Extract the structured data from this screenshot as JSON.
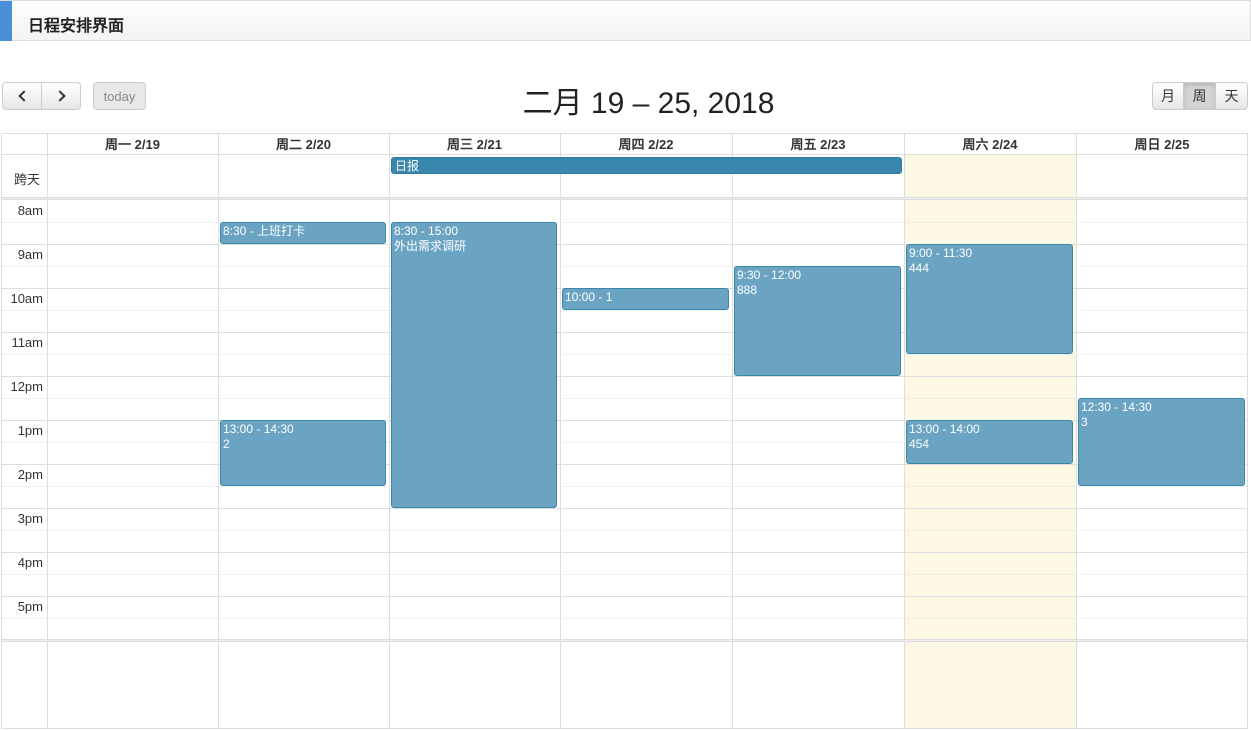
{
  "panel": {
    "title": "日程安排界面"
  },
  "toolbar": {
    "today_label": "today",
    "view_title": "二月 19 – 25, 2018",
    "views": {
      "month": "月",
      "week": "周",
      "day": "天"
    },
    "active_view": "周"
  },
  "calendar": {
    "allday_label": "跨天",
    "days": [
      {
        "label": "周一 2/19"
      },
      {
        "label": "周二 2/20"
      },
      {
        "label": "周三 2/21"
      },
      {
        "label": "周四 2/22"
      },
      {
        "label": "周五 2/23"
      },
      {
        "label": "周六 2/24"
      },
      {
        "label": "周日 2/25"
      }
    ],
    "hours": [
      "8am",
      "9am",
      "10am",
      "11am",
      "12pm",
      "1pm",
      "2pm",
      "3pm",
      "4pm",
      "5pm"
    ],
    "allday_events": [
      {
        "title": "日报",
        "start_day": "周三 2/21",
        "end_day": "周五 2/23"
      }
    ],
    "events": [
      {
        "day": "周二 2/20",
        "time": "8:30 - 上班打卡",
        "title": "",
        "start": 8.5,
        "end": 9.0
      },
      {
        "day": "周二 2/20",
        "time": "13:00 - 14:30",
        "title": "2",
        "start": 13.0,
        "end": 14.5
      },
      {
        "day": "周三 2/21",
        "time": "8:30 - 15:00",
        "title": "外出需求调研",
        "start": 8.5,
        "end": 15.0
      },
      {
        "day": "周四 2/22",
        "time": "10:00 - 1",
        "title": "",
        "start": 10.0,
        "end": 10.5
      },
      {
        "day": "周五 2/23",
        "time": "9:30 - 12:00",
        "title": "888",
        "start": 9.5,
        "end": 12.0
      },
      {
        "day": "周六 2/24",
        "time": "9:00 - 11:30",
        "title": "444",
        "start": 9.0,
        "end": 11.5
      },
      {
        "day": "周六 2/24",
        "time": "13:00 - 14:00",
        "title": "454",
        "start": 13.0,
        "end": 14.0
      },
      {
        "day": "周日 2/25",
        "time": "12:30 - 14:30",
        "title": "3",
        "start": 12.5,
        "end": 14.5
      }
    ]
  },
  "colors": {
    "event_bg": "#6aa4c2",
    "allday_event_bg": "#3a87ad",
    "weekend_highlight": "#fcf8e3",
    "accent": "#4a90d9"
  }
}
